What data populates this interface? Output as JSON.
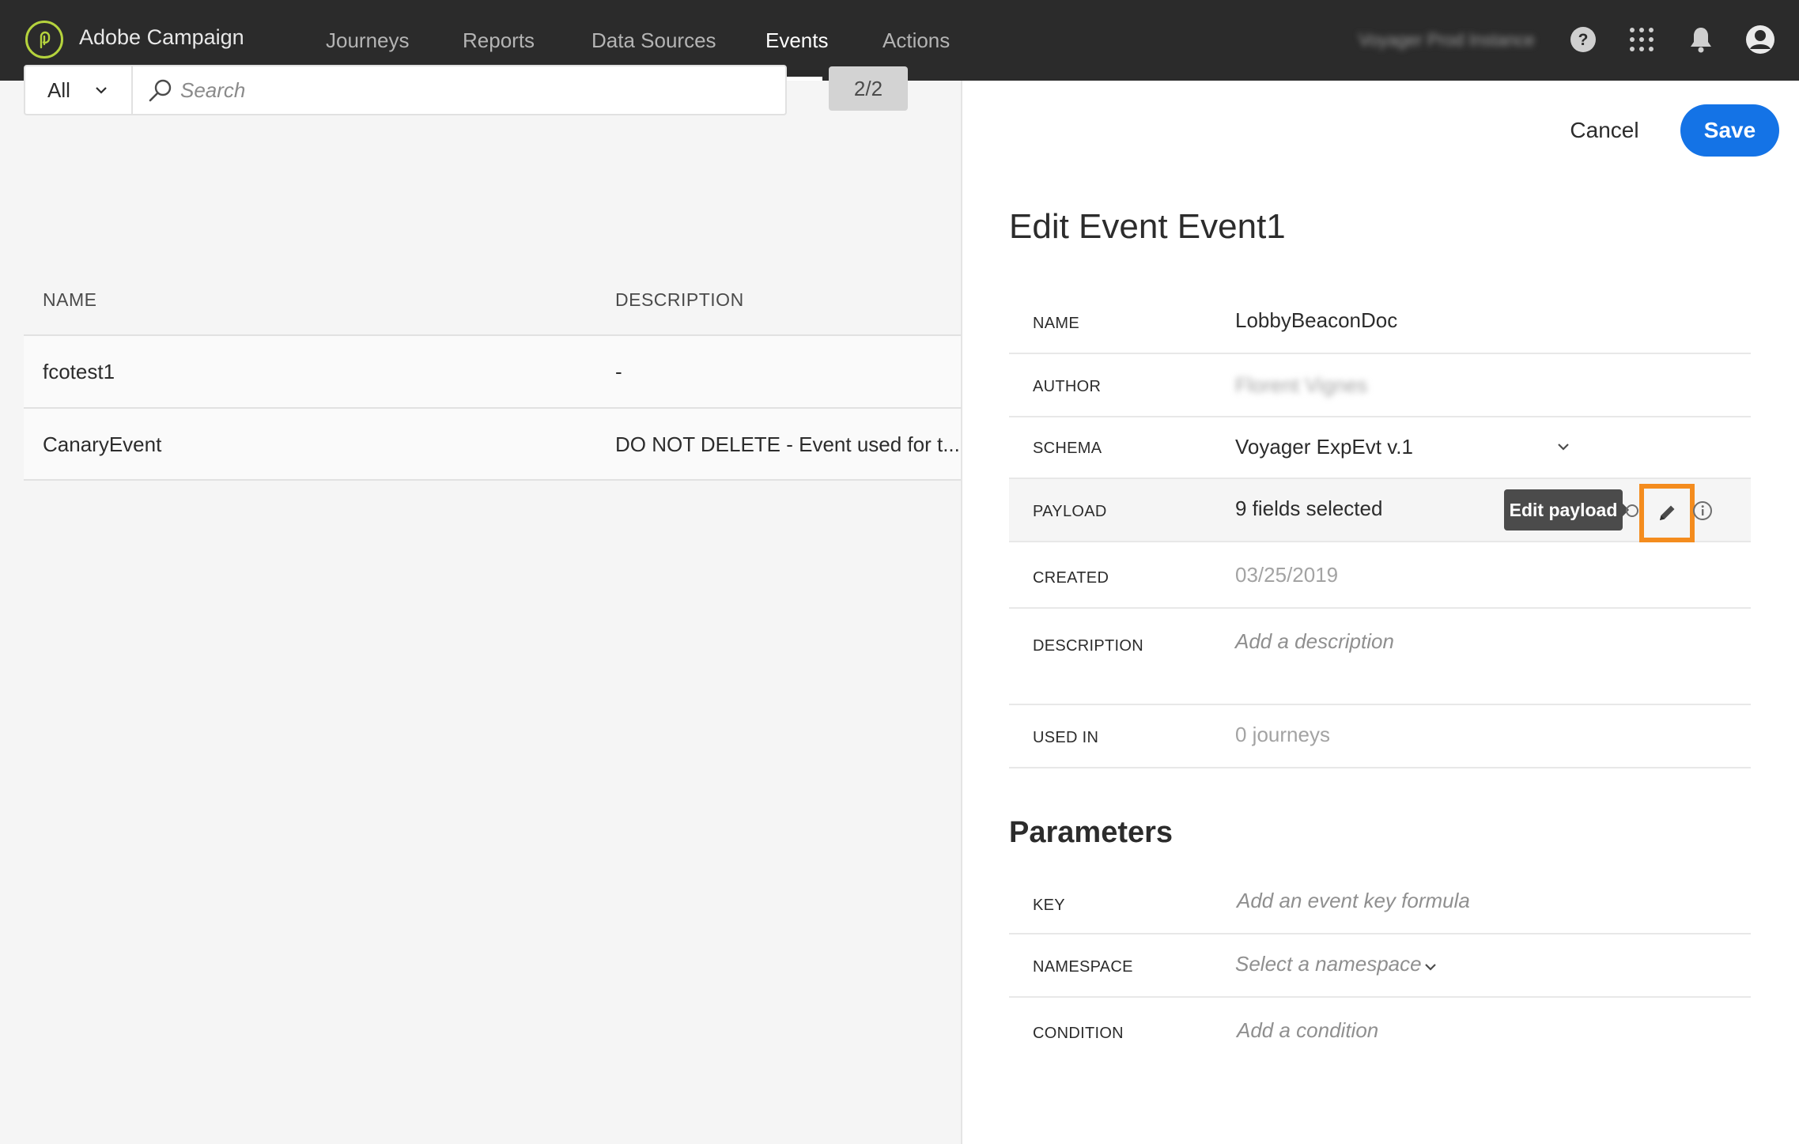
{
  "app": {
    "brand": "Adobe Campaign",
    "instance": "Voyager Prod Instance",
    "icons": [
      "help-icon",
      "apps-grid-icon",
      "bell-icon",
      "user-avatar-icon"
    ]
  },
  "nav": {
    "items": [
      {
        "label": "Journeys",
        "active": false
      },
      {
        "label": "Reports",
        "active": false
      },
      {
        "label": "Data Sources",
        "active": false
      },
      {
        "label": "Events",
        "active": true
      },
      {
        "label": "Actions",
        "active": false
      }
    ]
  },
  "list": {
    "filter_value": "All",
    "search_placeholder": "Search",
    "count": "2/2",
    "columns": {
      "name": "NAME",
      "description": "DESCRIPTION"
    },
    "rows": [
      {
        "name": "fcotest1",
        "description": "-"
      },
      {
        "name": "CanaryEvent",
        "description": "DO NOT DELETE - Event used for t..."
      }
    ]
  },
  "editor": {
    "cancel_label": "Cancel",
    "save_label": "Save",
    "title": "Edit Event Event1",
    "fields": {
      "name": {
        "label": "NAME",
        "value": "LobbyBeaconDoc"
      },
      "author": {
        "label": "AUTHOR",
        "value": "Florent Vignes"
      },
      "schema": {
        "label": "SCHEMA",
        "value": "Voyager ExpEvt v.1"
      },
      "payload": {
        "label": "PAYLOAD",
        "value": "9 fields selected",
        "tooltip": "Edit payload"
      },
      "created": {
        "label": "CREATED",
        "value": "03/25/2019"
      },
      "description": {
        "label": "DESCRIPTION",
        "placeholder": "Add a description"
      },
      "used_in": {
        "label": "USED IN",
        "value": "0 journeys"
      }
    },
    "parameters": {
      "title": "Parameters",
      "key": {
        "label": "KEY",
        "placeholder": "Add an event key formula"
      },
      "namespace": {
        "label": "NAMESPACE",
        "placeholder": "Select a namespace"
      },
      "condition": {
        "label": "CONDITION",
        "placeholder": "Add a condition"
      }
    }
  },
  "colors": {
    "topbar": "#2b2b2b",
    "accent_blue": "#1473e6",
    "highlight_orange": "#f48c1e",
    "logo_green": "#b5d33d"
  }
}
